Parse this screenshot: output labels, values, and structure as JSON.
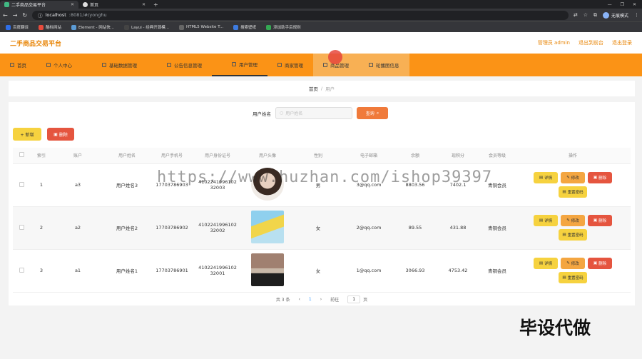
{
  "browser": {
    "tabs": [
      {
        "title": "二手商品交易平台",
        "active": true
      },
      {
        "title": "首页",
        "active": false
      }
    ],
    "url_host": "localhost",
    "url_rest": ":8081/#/yonghu",
    "profile_label": "无痕模式",
    "bookmarks": [
      "百度翻译",
      "酷标网站",
      "Element - 网站快...",
      "Layui - 经典开源模...",
      "HTML5 Website T...",
      "搜索壁纸",
      "添加助手后规则"
    ]
  },
  "header": {
    "title": "二手商品交易平台",
    "links": [
      "管理员 admin",
      "退出到前台",
      "退出登录"
    ]
  },
  "nav": {
    "items": [
      "首页",
      "个人中心",
      "基础数据管理",
      "公告信息管理",
      "用户管理",
      "商家管理",
      "商品管理",
      "轮播图信息"
    ]
  },
  "breadcrumb": {
    "home": "首页",
    "separator": "/",
    "current": "用户"
  },
  "search": {
    "label": "用户姓名",
    "placeholder": "用户姓名",
    "button": "查询"
  },
  "toolbar": {
    "add": "+ 新增",
    "delete": "删除"
  },
  "table": {
    "columns": [
      "索引",
      "账户",
      "用户姓名",
      "用户手机号",
      "用户身份证号",
      "用户头像",
      "性别",
      "电子邮箱",
      "余额",
      "现积分",
      "会员等级",
      "操作"
    ],
    "rows": [
      {
        "index": "1",
        "account": "a3",
        "name": "用户姓名3",
        "phone": "17703786903",
        "idcard": "410224199610232003",
        "gender": "男",
        "email": "3@qq.com",
        "balance": "8803.56",
        "points": "7402.1",
        "level": "青铜会员"
      },
      {
        "index": "2",
        "account": "a2",
        "name": "用户姓名2",
        "phone": "17703786902",
        "idcard": "410224199610232002",
        "gender": "女",
        "email": "2@qq.com",
        "balance": "89.55",
        "points": "431.88",
        "level": "青铜会员"
      },
      {
        "index": "3",
        "account": "a1",
        "name": "用户姓名1",
        "phone": "17703786901",
        "idcard": "410224199610232001",
        "gender": "女",
        "email": "1@qq.com",
        "balance": "3066.93",
        "points": "4753.42",
        "level": "青铜会员"
      }
    ],
    "row_actions": {
      "detail": "详情",
      "edit": "修改",
      "remove": "删除",
      "reset": "重置密码"
    }
  },
  "pager": {
    "total": "共 3 条",
    "prev": "‹",
    "page": "1",
    "next": "›",
    "goto": "前往",
    "goto_value": "1",
    "unit": "页"
  },
  "overlay": {
    "watermark": "https://www.huzhan.com/ishop39397",
    "brand": "毕设代做"
  },
  "colors": {
    "accent": "#fb9316",
    "title": "#e8870b",
    "danger": "#e5553f",
    "warning": "#f6d23f"
  }
}
